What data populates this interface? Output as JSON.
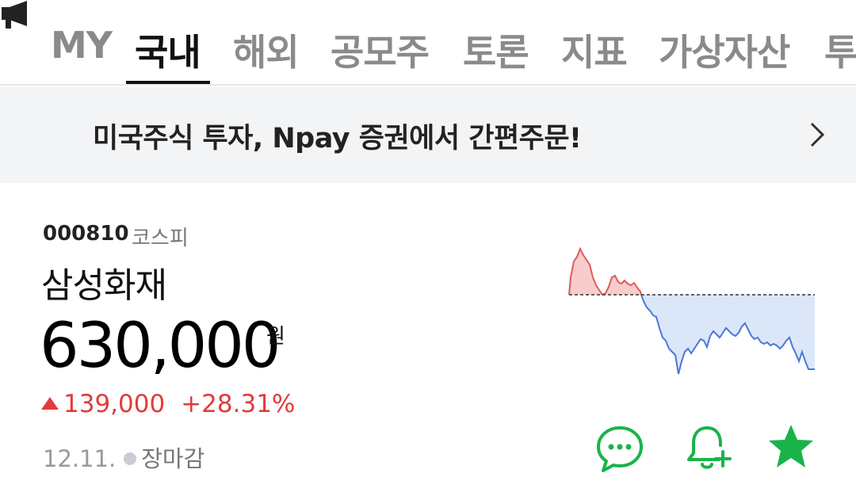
{
  "tabs": [
    {
      "label": "MY",
      "active": false
    },
    {
      "label": "국내",
      "active": true
    },
    {
      "label": "해외",
      "active": false
    },
    {
      "label": "공모주",
      "active": false
    },
    {
      "label": "토론",
      "active": false
    },
    {
      "label": "지표",
      "active": false
    },
    {
      "label": "가상자산",
      "active": false
    },
    {
      "label": "투",
      "active": false
    }
  ],
  "banner": {
    "icon": "megaphone-icon",
    "text": "미국주식 투자, Npay 증권에서 간편주문!",
    "arrow_icon": "chevron-right-icon"
  },
  "stock": {
    "code": "000810",
    "market": "코스피",
    "name": "삼성화재",
    "price": "630,000",
    "unit": "원",
    "change": "139,000",
    "change_rate": "+28.31%",
    "date": "12.11.",
    "status": "장마감"
  },
  "colors": {
    "up": "#e23b3b",
    "down": "#4a78d8",
    "accent_green": "#1ab34a",
    "banner_bg": "#f3f4f6"
  },
  "actions": [
    {
      "icon": "chat-icon"
    },
    {
      "icon": "alarm-add-icon"
    },
    {
      "icon": "star-icon"
    }
  ]
}
